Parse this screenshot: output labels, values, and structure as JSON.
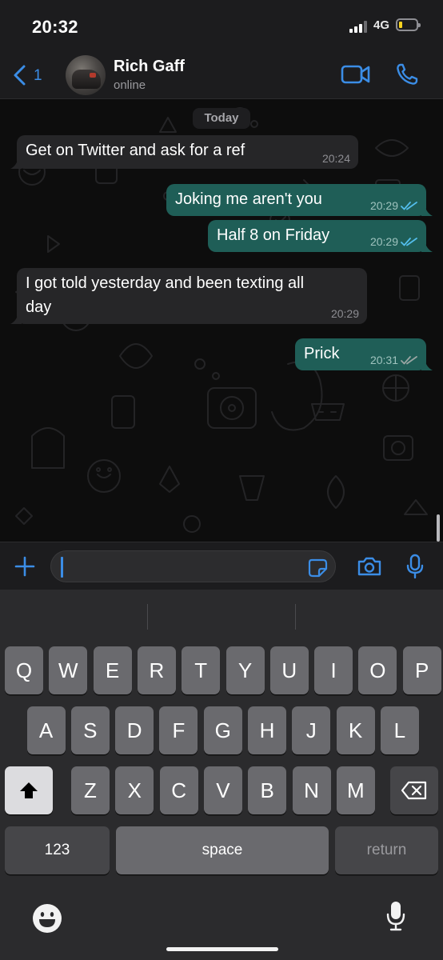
{
  "status_bar": {
    "time": "20:32",
    "network": "4G",
    "battery_level": 0.2
  },
  "header": {
    "back_count": "1",
    "contact_name": "Rich Gaff",
    "contact_status": "online",
    "accent_color": "#3b8de6"
  },
  "chat": {
    "day_label": "Today",
    "messages": [
      {
        "direction": "incoming",
        "lines": [
          "Get on Twitter and ask for a ref"
        ],
        "time": "20:24"
      },
      {
        "direction": "outgoing",
        "lines": [
          "Joking me aren't you"
        ],
        "time": "20:29",
        "read": true
      },
      {
        "direction": "outgoing",
        "lines": [
          "Half 8 on Friday"
        ],
        "time": "20:29",
        "read": true
      },
      {
        "direction": "incoming",
        "lines": [
          "I got told yesterday and been texting all",
          "day"
        ],
        "time": "20:29"
      },
      {
        "direction": "outgoing",
        "lines": [
          "Prick"
        ],
        "time": "20:31",
        "read": false
      }
    ]
  },
  "input": {
    "value": ""
  },
  "keyboard": {
    "row1": [
      "Q",
      "W",
      "E",
      "R",
      "T",
      "Y",
      "U",
      "I",
      "O",
      "P"
    ],
    "row2": [
      "A",
      "S",
      "D",
      "F",
      "G",
      "H",
      "J",
      "K",
      "L"
    ],
    "row3": [
      "Z",
      "X",
      "C",
      "V",
      "B",
      "N",
      "M"
    ],
    "numbers_label": "123",
    "space_label": "space",
    "return_label": "return"
  }
}
